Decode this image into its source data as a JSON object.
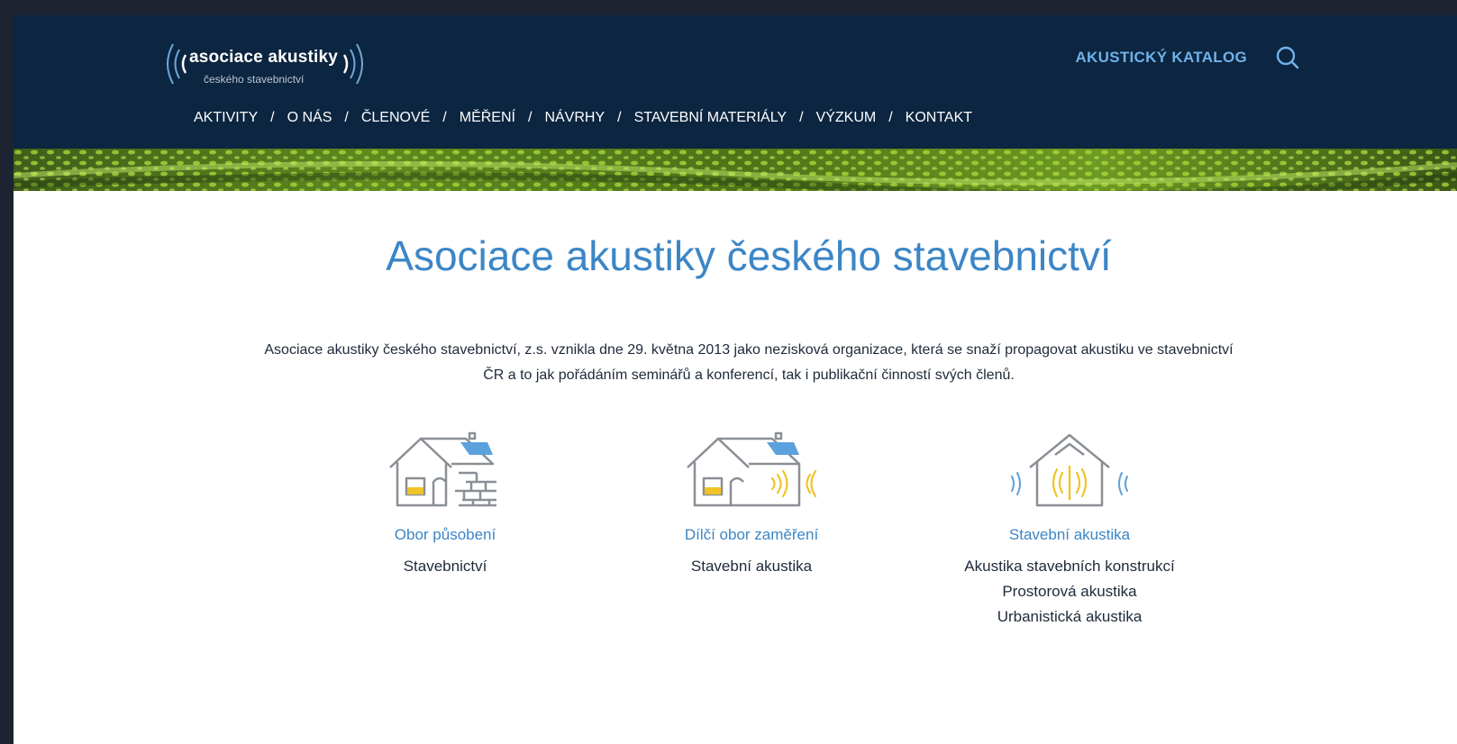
{
  "logo": {
    "name": "asociace akustiky",
    "tagline": "českého stavebnictví"
  },
  "header": {
    "katalog_label": "AKUSTICKÝ KATALOG"
  },
  "nav": {
    "items": [
      {
        "label": "AKTIVITY"
      },
      {
        "label": "O NÁS"
      },
      {
        "label": "ČLENOVÉ"
      },
      {
        "label": "MĚŘENÍ"
      },
      {
        "label": "NÁVRHY"
      },
      {
        "label": "STAVEBNÍ MATERIÁLY"
      },
      {
        "label": "VÝZKUM"
      },
      {
        "label": "KONTAKT"
      }
    ],
    "separator": "/"
  },
  "main": {
    "title": "Asociace akustiky českého stavebnictví",
    "intro": "Asociace akustiky českého stavebnictví, z.s. vznikla dne 29. května 2013 jako nezisková organizace, která se snaží propagovat akustiku ve stavebnictví ČR a to jak pořádáním seminářů a konferencí, tak i publikační činností svých členů.",
    "columns": [
      {
        "icon": "house-with-brick-wall-icon",
        "title": "Obor působení",
        "items": [
          "Stavebnictví"
        ]
      },
      {
        "icon": "house-with-sound-waves-icon",
        "title": "Dílčí obor zaměření",
        "items": [
          "Stavební akustika"
        ]
      },
      {
        "icon": "house-outline-sound-icon",
        "title": "Stavební akustika",
        "items": [
          "Akustika stavebních konstrukcí",
          "Prostorová akustika",
          "Urbanistická akustika"
        ]
      }
    ]
  },
  "colors": {
    "header_bg": "#0c2540",
    "accent_blue": "#3c86c6",
    "link_blue": "#6fb2ea",
    "icon_yellow": "#f2c329",
    "icon_gray": "#8a8f96",
    "banner_green": "#8bc01f"
  }
}
